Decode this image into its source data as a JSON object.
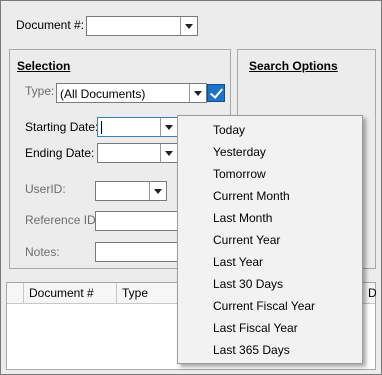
{
  "header": {
    "document_label": "Document #:",
    "document_value": ""
  },
  "selection": {
    "title": "Selection",
    "type_label": "Type:",
    "type_value": "(All Documents)",
    "starting_date_label": "Starting Date:",
    "starting_date_value": "",
    "ending_date_label": "Ending Date:",
    "ending_date_value": "",
    "userid_label": "UserID:",
    "userid_value": "",
    "reference_id_label": "Reference ID:",
    "reference_id_value": "",
    "notes_label": "Notes:",
    "notes_value": ""
  },
  "search_options": {
    "title": "Search Options"
  },
  "grid": {
    "columns": [
      "Document #",
      "Type",
      "D"
    ]
  },
  "date_dropdown": {
    "items": [
      "Today",
      "Yesterday",
      "Tomorrow",
      "Current Month",
      "Last Month",
      "Current Year",
      "Last Year",
      "Last 30 Days",
      "Current Fiscal Year",
      "Last Fiscal Year",
      "Last 365 Days"
    ]
  },
  "colors": {
    "window_bg": "#ececec",
    "check_accent": "#1c74c9",
    "focus_border": "#3c7fb1"
  }
}
